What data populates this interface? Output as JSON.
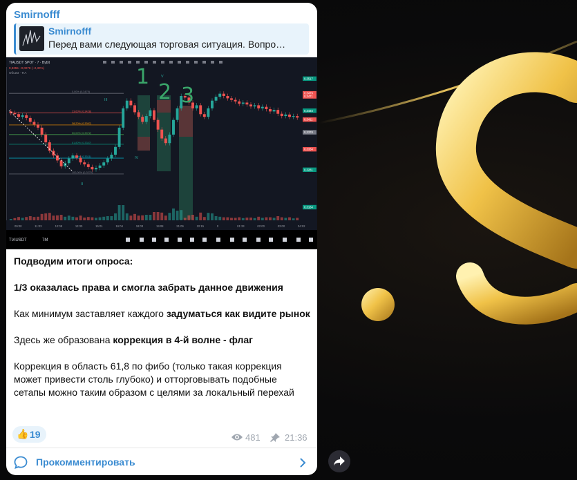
{
  "channel": {
    "name": "Smirnofff"
  },
  "reply": {
    "title": "Smirnofff",
    "text": "Перед вами следующая торговая ситуация.   Вопро…"
  },
  "chart": {
    "symbol_line": "TIAUSDT SPOT · 7 · Bybit",
    "price_change": "0,3355  −0,0078 (−2,30%)",
    "volume_label": "Объем · TIA",
    "ticker": "TIAUSDT",
    "timeframe": "7M",
    "wave_labels": [
      "1",
      "2",
      "3"
    ],
    "small_wave_labels": [
      "III",
      "IV",
      "V",
      "II"
    ],
    "fib_levels": [
      "0,00% (0,3479)",
      "23,60% (0,3428)",
      "38,20% (0,3397)",
      "50,00% (0,3372)",
      "61,80% (0,3347)",
      "78,60% (0,3311)",
      "100,00% (0,3270)"
    ],
    "price_tags": [
      "0,3517",
      "0,3479",
      "0,3471",
      "0,3434",
      "0,3411",
      "0,3378",
      "0,3334",
      "0,3281",
      "0,3184"
    ],
    "time_ticks": [
      "09:00",
      "11:03",
      "12:08",
      "13:30",
      "15:01",
      "16:04",
      "18:03",
      "19:08",
      "21:09",
      "22:15",
      "0",
      "01:33",
      "02:00",
      "03:00",
      "04:02"
    ],
    "series_close": [
      0.3428,
      0.3425,
      0.3418,
      0.3422,
      0.3415,
      0.3405,
      0.3398,
      0.339,
      0.3372,
      0.3352,
      0.333,
      0.3318,
      0.3305,
      0.329,
      0.3298,
      0.331,
      0.3318,
      0.3312,
      0.33,
      0.3295,
      0.3288,
      0.3282,
      0.3286,
      0.3292,
      0.33,
      0.331,
      0.332,
      0.334,
      0.339,
      0.344,
      0.346,
      0.3448,
      0.343,
      0.3418,
      0.3405,
      0.342,
      0.3435,
      0.341,
      0.3385,
      0.3362,
      0.335,
      0.3372,
      0.341,
      0.344,
      0.3472,
      0.3468,
      0.3455,
      0.344,
      0.3448,
      0.3425,
      0.3418,
      0.344,
      0.346,
      0.347,
      0.3478,
      0.3472,
      0.3466,
      0.3462,
      0.3458,
      0.3452,
      0.3455,
      0.345,
      0.3445,
      0.3448,
      0.344,
      0.3444,
      0.3438,
      0.3432,
      0.3436,
      0.3426,
      0.342,
      0.3424,
      0.3418,
      0.342,
      0.3416
    ]
  },
  "post": {
    "line1": "Подводим итоги опроса:",
    "line2": "1/3 оказалась права и смогла забрать данное движения",
    "line3_plain": "Как минимум заставляет каждого ",
    "line3_bold": "задуматься как видите рынок",
    "line4_plain": "Здесь же образована ",
    "line4_bold": "коррекция в 4-й волне - флаг",
    "line5": "Коррекция в область 61,8 по фибо (только такая коррекция может привести столь глубоко) и отторговывать подобные сетапы можно таким образом с целями за локальный перехай"
  },
  "reaction": {
    "emoji": "👍",
    "count": "19"
  },
  "meta": {
    "views": "481",
    "time": "21:36"
  },
  "comment": {
    "label": "Прокомментировать"
  },
  "colors": {
    "accent": "#3a8bd1",
    "bullish": "#26a69a",
    "bearish": "#ef5350"
  }
}
